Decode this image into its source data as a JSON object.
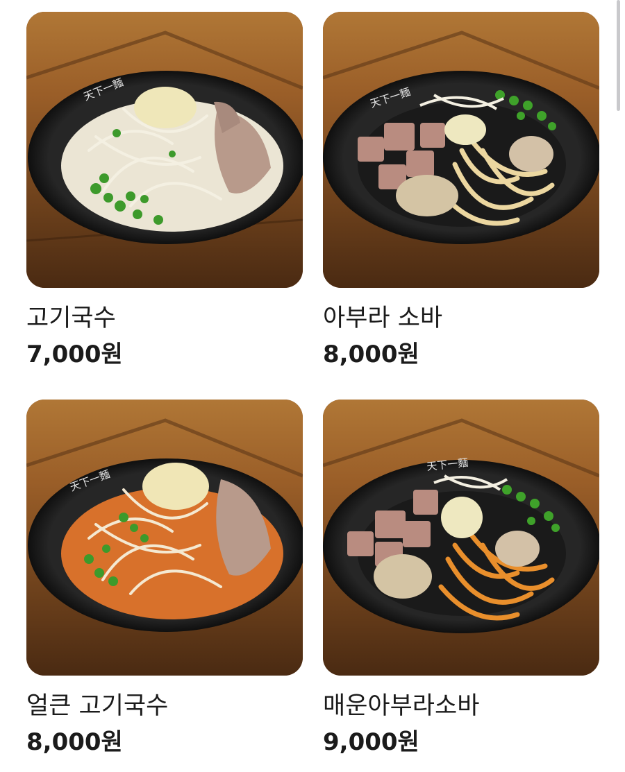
{
  "menu": {
    "items": [
      {
        "name": "고기국수",
        "price": "7,000원",
        "image": {
          "dish": "pork-noodle-soup",
          "broth_color": "#e9e3d2",
          "bowl_text": "天下一麵"
        }
      },
      {
        "name": "아부라 소바",
        "price": "8,000원",
        "image": {
          "dish": "abura-soba",
          "noodle_color": "#e8d39e",
          "bowl_text": "天下一麵"
        }
      },
      {
        "name": "얼큰 고기국수",
        "price": "8,000원",
        "image": {
          "dish": "spicy-pork-noodle-soup",
          "broth_color": "#d9742e",
          "bowl_text": "天下一麵"
        }
      },
      {
        "name": "매운아부라소바",
        "price": "9,000원",
        "image": {
          "dish": "spicy-abura-soba",
          "noodle_color": "#e7942e",
          "bowl_text": "天下一麵"
        }
      }
    ]
  },
  "colors": {
    "text": "#1b1b1b",
    "wood_dark": "#5a3216",
    "wood_light": "#a8692f",
    "bowl": "#1c1c1c"
  }
}
